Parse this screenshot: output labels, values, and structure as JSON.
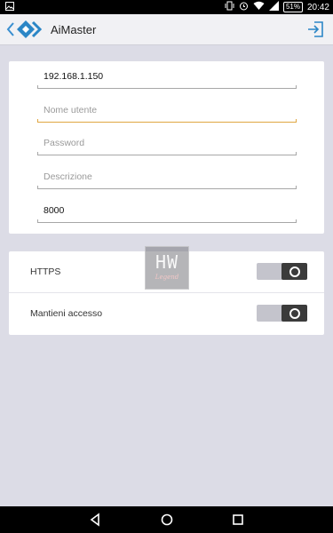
{
  "status_bar": {
    "battery": "51%",
    "time": "20:42"
  },
  "app_bar": {
    "title": "AiMaster"
  },
  "form": {
    "host": {
      "value": "192.168.1.150"
    },
    "username": {
      "placeholder": "Nome utente"
    },
    "password": {
      "placeholder": "Password"
    },
    "description": {
      "placeholder": "Descrizione"
    },
    "port": {
      "value": "8000"
    }
  },
  "settings": {
    "https": {
      "label": "HTTPS",
      "enabled": true
    },
    "keep_login": {
      "label": "Mantieni accesso",
      "enabled": true
    }
  },
  "watermark": {
    "mark": "HW",
    "text": "Legend"
  },
  "colors": {
    "focus_underline": "#e0a642",
    "logo_blue": "#2b86c6",
    "back_arrow": "#3a8fd0"
  }
}
